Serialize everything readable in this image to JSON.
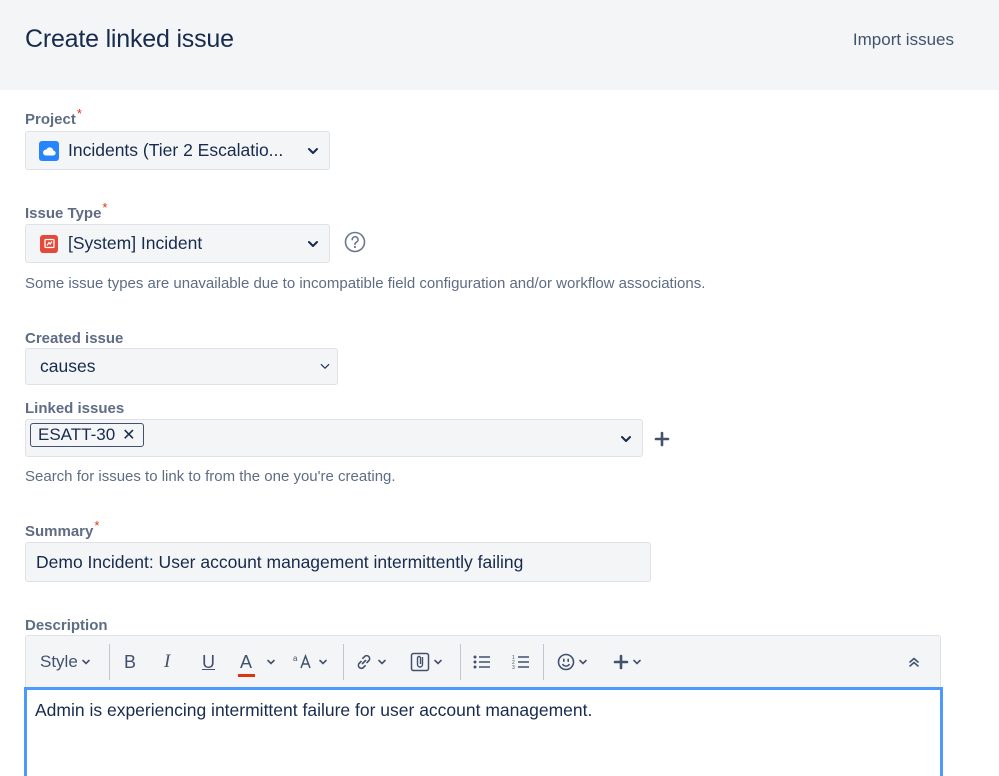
{
  "header": {
    "title": "Create linked issue",
    "import_label": "Import issues"
  },
  "project": {
    "label": "Project",
    "required": "*",
    "value": "Incidents (Tier 2 Escalatio...",
    "icon": "cloud-project-icon"
  },
  "issue_type": {
    "label": "Issue Type",
    "required": "*",
    "value": "[System] Incident",
    "icon": "incident-icon",
    "hint": "Some issue types are unavailable due to incompatible field configuration and/or workflow associations."
  },
  "created_issue": {
    "label": "Created issue",
    "value": "causes"
  },
  "linked_issues": {
    "label": "Linked issues",
    "tags": [
      "ESATT-30"
    ],
    "hint": "Search for issues to link to from the one you're creating."
  },
  "summary": {
    "label": "Summary",
    "required": "*",
    "value": "Demo Incident: User account management intermittently failing"
  },
  "description": {
    "label": "Description",
    "toolbar": {
      "style_label": "Style",
      "bold": "B",
      "italic": "I",
      "underline": "U",
      "text_color": "A"
    },
    "content": "Admin is experiencing intermittent failure for user account management."
  },
  "colors": {
    "accent": "#4c9aff",
    "required": "#de350b",
    "text_color_underline": "#de350b"
  }
}
